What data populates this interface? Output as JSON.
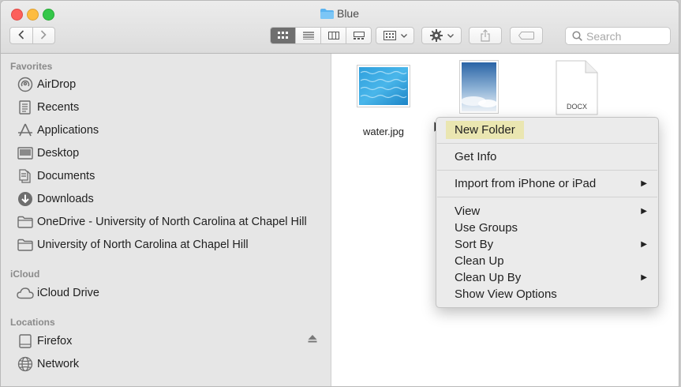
{
  "window": {
    "title": "Blue"
  },
  "toolbar": {
    "search_placeholder": "Search"
  },
  "sidebar": {
    "favorites_title": "Favorites",
    "favorites": [
      {
        "label": "AirDrop",
        "icon": "airdrop-icon"
      },
      {
        "label": "Recents",
        "icon": "recents-icon"
      },
      {
        "label": "Applications",
        "icon": "applications-icon"
      },
      {
        "label": "Desktop",
        "icon": "desktop-icon"
      },
      {
        "label": "Documents",
        "icon": "documents-icon"
      },
      {
        "label": "Downloads",
        "icon": "downloads-icon"
      },
      {
        "label": "OneDrive - University of North Carolina at Chapel Hill",
        "icon": "folder-icon"
      },
      {
        "label": "University of North Carolina at Chapel Hill",
        "icon": "folder-icon"
      }
    ],
    "icloud_title": "iCloud",
    "icloud": [
      {
        "label": "iCloud Drive",
        "icon": "cloud-icon"
      }
    ],
    "locations_title": "Locations",
    "locations": [
      {
        "label": "Firefox",
        "icon": "disk-icon"
      },
      {
        "label": "Network",
        "icon": "network-icon"
      }
    ]
  },
  "files": [
    {
      "label": "water.jpg",
      "icon": "water-image-thumbnail"
    },
    {
      "label": "",
      "icon": "sky-image-thumbnail"
    },
    {
      "label": "",
      "badge": "DOCX",
      "icon": "docx-file-icon"
    }
  ],
  "context_menu": {
    "items": [
      {
        "label": "New Folder"
      },
      {
        "label": "Get Info"
      },
      {
        "label": "Import from iPhone or iPad"
      },
      {
        "label": "View"
      },
      {
        "label": "Use Groups"
      },
      {
        "label": "Sort By"
      },
      {
        "label": "Clean Up"
      },
      {
        "label": "Clean Up By"
      },
      {
        "label": "Show View Options"
      }
    ]
  },
  "colors": {
    "sidebar_bg": "#e6e6e6",
    "menu_bg": "#ebebeb",
    "menu_highlight": "#eae6b1",
    "folder_accent": "#5ab3f0"
  }
}
